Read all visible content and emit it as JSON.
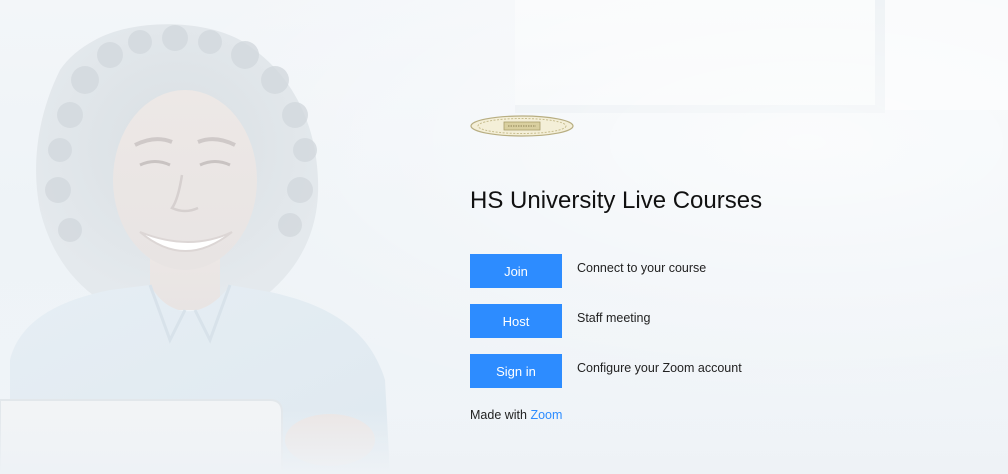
{
  "page": {
    "logo_alt": "HS University",
    "title": "HS University Live Courses"
  },
  "actions": [
    {
      "button": "Join",
      "description": "Connect to your course"
    },
    {
      "button": "Host",
      "description": "Staff meeting"
    },
    {
      "button": "Sign in",
      "description": "Configure your Zoom account"
    }
  ],
  "footer": {
    "prefix": "Made with",
    "link": "Zoom"
  },
  "colors": {
    "accent": "#2d8cff",
    "title": "#111111",
    "background": "#eef3f7"
  },
  "icons": {
    "logo": "university-seal-logo"
  }
}
